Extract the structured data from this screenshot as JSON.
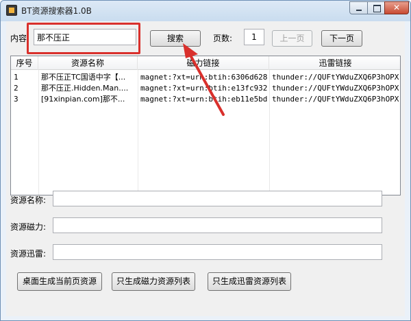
{
  "window": {
    "title": "BT资源搜索器1.0B"
  },
  "search": {
    "label": "内容:",
    "value": "那不压正",
    "button": "搜索",
    "page_label": "页数:",
    "page_value": "1",
    "prev": "上一页",
    "next": "下一页"
  },
  "table": {
    "headers": [
      "序号",
      "资源名称",
      "磁力链接",
      "迅雷链接"
    ],
    "rows": [
      {
        "idx": "1",
        "name": "那不压正TC国语中字【...",
        "magnet": "magnet:?xt=urn:btih:6306d628...",
        "thunder": "thunder://QUFtYWduZXQ6P3hOPX..."
      },
      {
        "idx": "2",
        "name": "那不压正.Hidden.Man....",
        "magnet": "magnet:?xt=urn:btih:e13fc932...",
        "thunder": "thunder://QUFtYWduZXQ6P3hOPX..."
      },
      {
        "idx": "3",
        "name": "[91xinpian.com]那不...",
        "magnet": "magnet:?xt=urn:btih:eb11e5bd...",
        "thunder": "thunder://QUFtYWduZXQ6P3hOPX..."
      }
    ]
  },
  "details": {
    "name_label": "资源名称:",
    "magnet_label": "资源磁力:",
    "thunder_label": "资源迅雷:",
    "name_value": "",
    "magnet_value": "",
    "thunder_value": ""
  },
  "actions": {
    "desktop": "桌面生成当前页资源",
    "magnet_list": "只生成磁力资源列表",
    "thunder_list": "只生成迅雷资源列表"
  },
  "colors": {
    "highlight": "#d9302c",
    "arrow": "#d9302c"
  },
  "icons": [
    "app-icon",
    "minimize-icon",
    "maximize-icon",
    "close-icon",
    "arrow-annotation"
  ]
}
